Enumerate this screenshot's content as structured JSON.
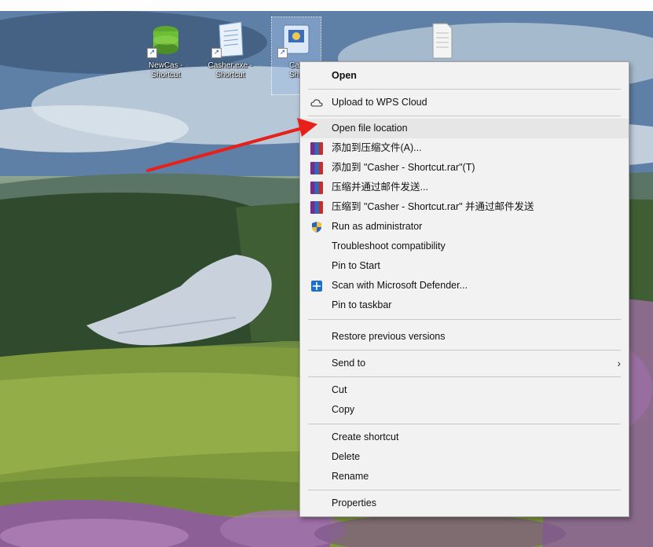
{
  "desktop": {
    "icons": [
      {
        "label_line1": "NewCas -",
        "label_line2": "Shortcut",
        "icon": "green-stack-icon"
      },
      {
        "label_line1": "Casher.exe -",
        "label_line2": "Shortcut",
        "icon": "notepad-icon"
      },
      {
        "label_line1": "Cas",
        "label_line2": "Sho",
        "icon": "app-shortcut-icon"
      },
      {
        "label_line1": "",
        "label_line2": "",
        "icon": "document-icon"
      }
    ]
  },
  "menu": {
    "items": [
      {
        "label": "Open",
        "icon": ""
      },
      {
        "label": "Upload to WPS Cloud",
        "icon": "cloud-icon"
      },
      {
        "label": "Open file location",
        "icon": ""
      },
      {
        "label": "添加到压缩文件(A)...",
        "icon": "winrar-icon"
      },
      {
        "label": "添加到 \"Casher - Shortcut.rar\"(T)",
        "icon": "winrar-icon"
      },
      {
        "label": "压缩并通过邮件发送...",
        "icon": "winrar-icon"
      },
      {
        "label": "压缩到 \"Casher - Shortcut.rar\" 并通过邮件发送",
        "icon": "winrar-icon"
      },
      {
        "label": "Run as administrator",
        "icon": "shield-icon"
      },
      {
        "label": "Troubleshoot compatibility",
        "icon": ""
      },
      {
        "label": "Pin to Start",
        "icon": ""
      },
      {
        "label": "Scan with Microsoft Defender...",
        "icon": "defender-icon"
      },
      {
        "label": "Pin to taskbar",
        "icon": ""
      },
      {
        "label": "Restore previous versions",
        "icon": ""
      },
      {
        "label": "Send to",
        "icon": ""
      },
      {
        "label": "Cut",
        "icon": ""
      },
      {
        "label": "Copy",
        "icon": ""
      },
      {
        "label": "Create shortcut",
        "icon": ""
      },
      {
        "label": "Delete",
        "icon": ""
      },
      {
        "label": "Rename",
        "icon": ""
      },
      {
        "label": "Properties",
        "icon": ""
      }
    ],
    "submenu_indicator": "›",
    "highlighted": "Open file location"
  },
  "annotation": {
    "arrow_color": "#e8201a"
  }
}
